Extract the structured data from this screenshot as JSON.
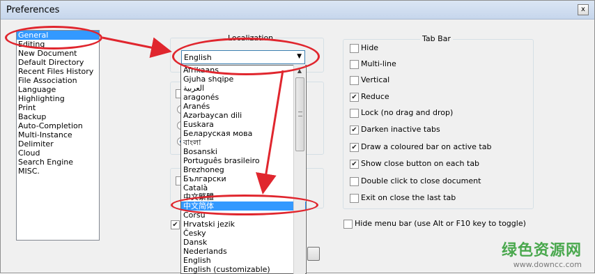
{
  "window": {
    "title": "Preferences",
    "close_glyph": "x"
  },
  "categories": [
    {
      "label": "General",
      "selected": true
    },
    {
      "label": "Editing"
    },
    {
      "label": "New Document"
    },
    {
      "label": "Default Directory"
    },
    {
      "label": "Recent Files History"
    },
    {
      "label": "File Association"
    },
    {
      "label": "Language"
    },
    {
      "label": "Highlighting"
    },
    {
      "label": "Print"
    },
    {
      "label": "Backup"
    },
    {
      "label": "Auto-Completion"
    },
    {
      "label": "Multi-Instance"
    },
    {
      "label": "Delimiter"
    },
    {
      "label": "Cloud"
    },
    {
      "label": "Search Engine"
    },
    {
      "label": "MISC."
    }
  ],
  "localization": {
    "title": "Localization",
    "selected_value": "English",
    "options": [
      "Afrikaans",
      "Gjuha shqipe",
      "العربية",
      "aragonés",
      "Aranés",
      "Azərbaycan dili",
      "Euskara",
      "Беларуская мова",
      "বাংলা",
      "Bosanski",
      "Português brasileiro",
      "Brezhoneg",
      "Български",
      "Català",
      "中文繁體",
      "中文简体",
      "Corsu",
      "Hrvatski jezik",
      "Česky",
      "Dansk",
      "Nederlands",
      "English",
      "English (customizable)"
    ],
    "highlighted_option": "中文简体"
  },
  "tabbar": {
    "title": "Tab Bar",
    "options": [
      {
        "label": "Hide",
        "checked": false
      },
      {
        "label": "Multi-line",
        "checked": false
      },
      {
        "label": "Vertical",
        "checked": false
      },
      {
        "label": "Reduce",
        "checked": true
      },
      {
        "label": "Lock (no drag and drop)",
        "checked": false
      },
      {
        "label": "Darken inactive tabs",
        "checked": true
      },
      {
        "label": "Draw a coloured bar on active tab",
        "checked": true
      },
      {
        "label": "Show close button on each tab",
        "checked": true
      },
      {
        "label": "Double click to close document",
        "checked": false
      },
      {
        "label": "Exit on close the last tab",
        "checked": false
      }
    ]
  },
  "hide_menu_bar": {
    "label": "Hide menu bar (use Alt or F10 key to toggle)",
    "checked": false
  },
  "check_glyph": "✔",
  "watermark": {
    "main": "绿色资源网",
    "url": "www.downcc.com"
  },
  "colors": {
    "selection": "#3399ff",
    "annotation": "#e0262e",
    "watermark": "#4aa84e"
  }
}
